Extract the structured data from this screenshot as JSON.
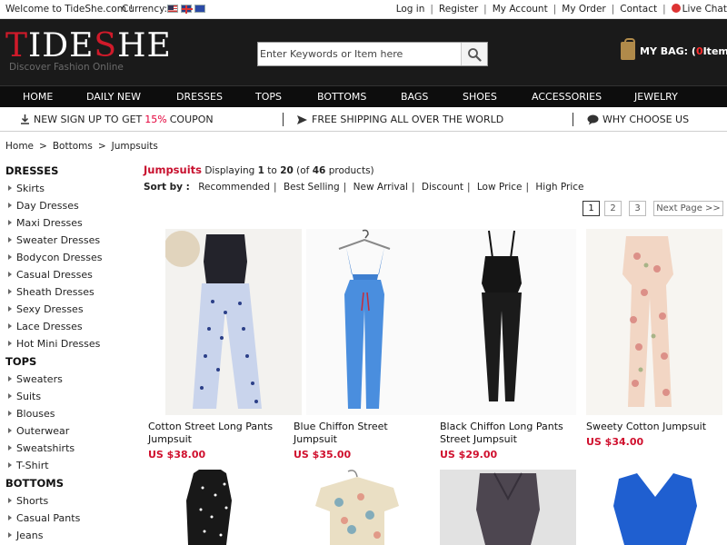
{
  "topbar": {
    "welcome": "Welcome to TideShe.com !",
    "currency_label": "Currency:",
    "links": [
      "Log in",
      "Register",
      "My Account",
      "My Order",
      "Contact"
    ],
    "live_chat": "Live Chat"
  },
  "header": {
    "logo_main_a": "T",
    "logo_main_b": "IDE",
    "logo_main_c": "S",
    "logo_main_d": "HE",
    "logo_sub": "Discover Fashion Online",
    "search_placeholder": "Enter Keywords or Item here",
    "bag_prefix": "MY BAG: ( ",
    "bag_count": "0",
    "bag_suffix": " Items )"
  },
  "nav": [
    "HOME",
    "DAILY NEW",
    "DRESSES",
    "TOPS",
    "BOTTOMS",
    "BAGS",
    "SHOES",
    "ACCESSORIES",
    "JEWELRY"
  ],
  "promo": {
    "signup_a": "NEW SIGN UP TO GET",
    "signup_pct": "15%",
    "signup_b": "COUPON",
    "shipping": "FREE SHIPPING ALL OVER THE WORLD",
    "why": "WHY CHOOSE US"
  },
  "breadcrumb": [
    "Home",
    "Bottoms",
    "Jumpsuits"
  ],
  "sidebar": {
    "dresses_title": "DRESSES",
    "dresses": [
      "Skirts",
      "Day Dresses",
      "Maxi Dresses",
      "Sweater Dresses",
      "Bodycon Dresses",
      "Casual Dresses",
      "Sheath Dresses",
      "Sexy Dresses",
      "Lace Dresses",
      "Hot Mini Dresses"
    ],
    "tops_title": "TOPS",
    "tops": [
      "Sweaters",
      "Suits",
      "Blouses",
      "Outerwear",
      "Sweatshirts",
      "T-Shirt"
    ],
    "bottoms_title": "BOTTOMS",
    "bottoms": [
      "Shorts",
      "Casual Pants",
      "Jeans"
    ]
  },
  "listing": {
    "title": "Jumpsuits",
    "displaying": "Displaying",
    "from": "1",
    "to_word": "to",
    "to": "20",
    "of_a": "(of",
    "total": "46",
    "of_b": "products)",
    "sort_label": "Sort by :",
    "sort_options": [
      "Recommended",
      "Best Selling",
      "New Arrival",
      "Discount",
      "Low Price",
      "High Price"
    ],
    "pages": [
      "1",
      "2",
      "3"
    ],
    "next": "Next Page >>"
  },
  "products": [
    {
      "name": "Cotton Street Long Pants Jumpsuit",
      "price": "US $38.00"
    },
    {
      "name": "Blue Chiffon Street Jumpsuit",
      "price": "US $35.00"
    },
    {
      "name": "Black Chiffon Long Pants Street Jumpsuit",
      "price": "US $29.00"
    },
    {
      "name": "Sweety Cotton Jumpsuit",
      "price": "US $34.00"
    }
  ],
  "colors": {
    "accent_red": "#c8102e",
    "header_bg": "#1a1a1a",
    "nav_bg": "#0d0d0d",
    "price_red": "#d0102e"
  }
}
